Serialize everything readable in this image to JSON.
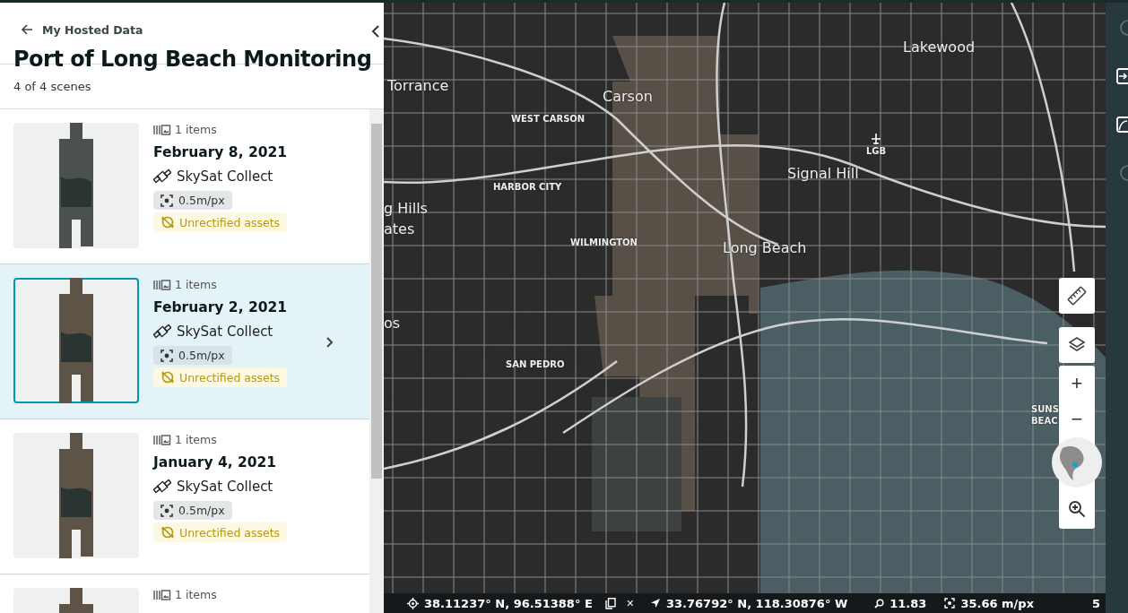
{
  "panel": {
    "back_link": "My Hosted Data",
    "title": "Port of Long Beach Monitoring",
    "count": "4 of 4 scenes"
  },
  "scenes": [
    {
      "items": "1 items",
      "date": "February 8, 2021",
      "source": "SkySat Collect",
      "resolution": "0.5m/px",
      "warning": "Unrectified assets",
      "selected": false
    },
    {
      "items": "1 items",
      "date": "February 2, 2021",
      "source": "SkySat Collect",
      "resolution": "0.5m/px",
      "warning": "Unrectified assets",
      "selected": true
    },
    {
      "items": "1 items",
      "date": "January 4, 2021",
      "source": "SkySat Collect",
      "resolution": "0.5m/px",
      "warning": "Unrectified assets",
      "selected": false
    },
    {
      "items": "1 items",
      "selected": false
    }
  ],
  "map": {
    "labels": [
      {
        "text": "Lakewood",
        "kind": "city"
      },
      {
        "text": "Torrance",
        "kind": "city"
      },
      {
        "text": "Carson",
        "kind": "city"
      },
      {
        "text": "WEST CARSON",
        "kind": "district"
      },
      {
        "text": "LGB",
        "kind": "airport"
      },
      {
        "text": "Signal Hill",
        "kind": "city"
      },
      {
        "text": "HARBOR CITY",
        "kind": "district"
      },
      {
        "text": "g Hills",
        "kind": "city"
      },
      {
        "text": "ates",
        "kind": "city"
      },
      {
        "text": "WILMINGTON",
        "kind": "district"
      },
      {
        "text": "Long Beach",
        "kind": "city"
      },
      {
        "text": "os",
        "kind": "city"
      },
      {
        "text": "SAN PEDRO",
        "kind": "district"
      },
      {
        "text": "SUNS",
        "kind": "district"
      },
      {
        "text": "BEAC",
        "kind": "district"
      }
    ],
    "zoom_in": "+",
    "zoom_out": "−"
  },
  "status_bar": {
    "cursor_coords": "38.11237° N, 96.51388° E",
    "clear": "×",
    "center_coords": "33.76792° N, 118.30876° W",
    "zoom": "11.83",
    "scale": "35.66 m/px",
    "page": "5"
  }
}
